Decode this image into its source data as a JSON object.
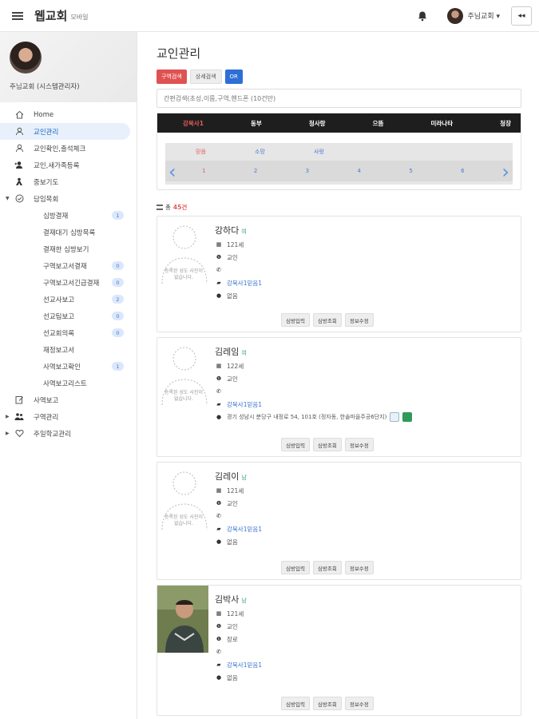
{
  "header": {
    "title": "웹교회",
    "subtitle": "모바일",
    "user_name": "주님교회 ▾",
    "collapse_label": "◂◂"
  },
  "sidebar": {
    "profile_name": "주님교회 (시스템관리자)",
    "items": [
      {
        "label": "Home",
        "icon": "home-icon"
      },
      {
        "label": "교인관리",
        "icon": "user-icon",
        "active": true
      },
      {
        "label": "교인확인,출석체크",
        "icon": "user-check-icon"
      },
      {
        "label": "교인,새가족등록",
        "icon": "user-add-icon"
      },
      {
        "label": "중보기도",
        "icon": "pray-icon"
      },
      {
        "label": "담임목회",
        "icon": "check-circle-icon"
      }
    ],
    "sub_items": [
      {
        "label": "심방결재",
        "badge": "1"
      },
      {
        "label": "결재대기 심방목록",
        "badge": ""
      },
      {
        "label": "결재한 심방보기",
        "badge": ""
      },
      {
        "label": "구역보고서결재",
        "badge": "0"
      },
      {
        "label": "구역보고서긴급결재",
        "badge": "0"
      },
      {
        "label": "선교사보고",
        "badge": "2"
      },
      {
        "label": "선교팀보고",
        "badge": "0"
      },
      {
        "label": "선교회의록",
        "badge": "0"
      },
      {
        "label": "재정보고서",
        "badge": ""
      },
      {
        "label": "사역보고확인",
        "badge": "1"
      },
      {
        "label": "사역보고리스트",
        "badge": ""
      }
    ],
    "bottom_items": [
      {
        "label": "사역보고",
        "icon": "edit-icon"
      },
      {
        "label": "구역관리",
        "icon": "group-icon"
      },
      {
        "label": "주일학교관리",
        "icon": "heart-icon"
      }
    ]
  },
  "main": {
    "title": "교인관리",
    "buttons": {
      "area_search": "구역검색",
      "detail_search": "상세검색",
      "or": "OR"
    },
    "search_placeholder": "간편검색(초성,이름,구역,핸드폰 (10건만)",
    "area_tabs": [
      "강북사1",
      "동부",
      "청사랑",
      "으뜸",
      "미라나타",
      "청장"
    ],
    "sub_tabs": [
      "믿음",
      "소망",
      "사랑"
    ],
    "sub_numbers": [
      "1",
      "2",
      "3",
      "4",
      "5",
      "6"
    ],
    "total_prefix": "총",
    "total_count": "45건"
  },
  "no_photo_text": "등록된 성도 사진이 없습니다.",
  "action_labels": {
    "visit_input": "심방입력",
    "visit_view": "심방조회",
    "edit_info": "정보수정"
  },
  "members": [
    {
      "name": "강하다",
      "gender": "여",
      "age": "121세",
      "role": "교인",
      "role2": "",
      "phone": "",
      "area": "강북사1믿음1",
      "address": "없음",
      "has_photo": false,
      "has_map": false
    },
    {
      "name": "김레임",
      "gender": "여",
      "age": "122세",
      "role": "교인",
      "role2": "",
      "phone": "",
      "area": "강북사1믿음1",
      "address": "경기 성남시 분당구 내정로 54, 101호 (정자동, 한솔마을주공6단지)",
      "has_photo": false,
      "has_map": true
    },
    {
      "name": "김레이",
      "gender": "남",
      "age": "121세",
      "role": "교인",
      "role2": "",
      "phone": "",
      "area": "강북사1믿음1",
      "address": "없음",
      "has_photo": false,
      "has_map": false
    },
    {
      "name": "김박사",
      "gender": "남",
      "age": "121세",
      "role": "교인",
      "role2": "장로",
      "phone": "",
      "area": "강북사1믿음1",
      "address": "없음",
      "has_photo": true,
      "has_map": false
    }
  ],
  "colors": {
    "accent_red": "#e05252",
    "link_blue": "#3a74d0",
    "dark_tab": "#1e1e1e"
  }
}
